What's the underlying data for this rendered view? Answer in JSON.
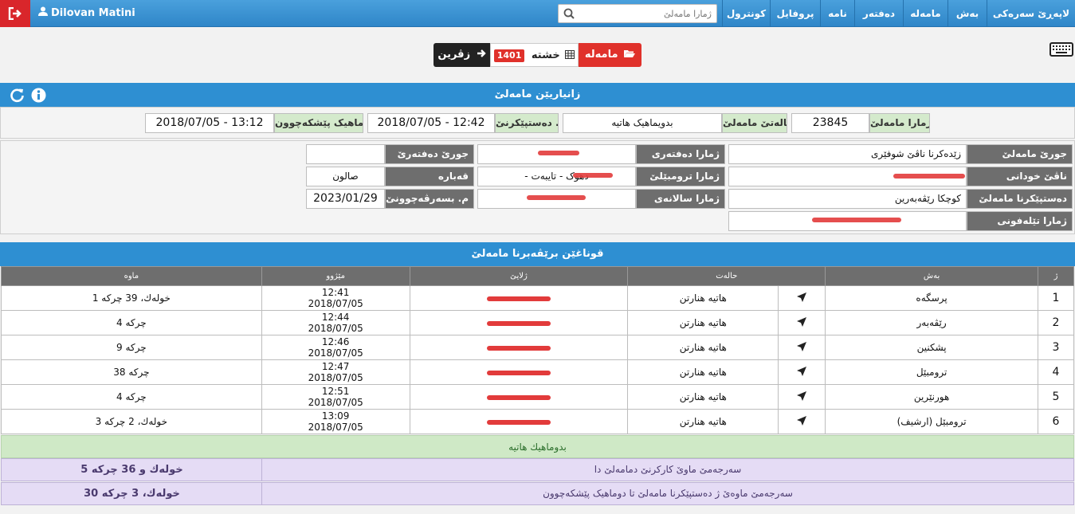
{
  "nav": {
    "user": "Dilovan Matini",
    "search_placeholder": "ژمارا مامەلێ",
    "items": [
      {
        "label": "لاپەڕێ سەرەکی"
      },
      {
        "label": "بەش"
      },
      {
        "label": "مامەلە"
      },
      {
        "label": "دەفتەر"
      },
      {
        "label": "نامە"
      },
      {
        "label": "پروفایل"
      },
      {
        "label": "کونترول"
      }
    ]
  },
  "buttons": {
    "case": "مامەلە",
    "steps": "خشتە",
    "steps_count": "1401",
    "back": "زڤرین"
  },
  "info_panel": {
    "title": "زانیاریێن مامەلێ",
    "case_number_label": "ژمارا مامەلێ",
    "case_number": "23845",
    "status_label": "حالەتێ مامەلێ",
    "status": "بدویماهیک هاتیە",
    "start_label": "م. دەستپێکرنێ",
    "start": "2018/07/05 - 12:42",
    "end_label": "دوماهیک پێشکەچوون",
    "end": "2018/07/05 - 13:12"
  },
  "details": {
    "col1": [
      {
        "label": "جورێ مامەلێ",
        "value": "زێدەکرنا ناڤێ شوفێری"
      },
      {
        "label": "ناڤێ خودانی",
        "value": ""
      },
      {
        "label": "دەستپێکرنا مامەلێ",
        "value": "کوچکا رێڤەبەرین"
      },
      {
        "label": "ژمارا تێلەفونی",
        "value": ""
      }
    ],
    "col2": [
      {
        "label": "ژمارا دەفتەری",
        "value": ""
      },
      {
        "label": "ژمارا ترومبێلێ",
        "value": "- دهوک - تایبەت"
      },
      {
        "label": "ژمارا سالانەی",
        "value": ""
      }
    ],
    "col3": [
      {
        "label": "جورێ دەفتەرێ",
        "value": ""
      },
      {
        "label": "قەبارە",
        "value": "صالون"
      },
      {
        "label": "م. بسەرڤەچوونێ",
        "value": "2023/01/29"
      }
    ]
  },
  "steps_panel": {
    "title": "قوناغێن برێڤەبرنا مامەلێ",
    "headers": {
      "no": "ژ",
      "dept": "بەش",
      "status": "حالەت",
      "user": "ژلایێ",
      "date": "مێژوو",
      "duration": "ماوە"
    },
    "rows": [
      {
        "no": "1",
        "dept": "پرسگەه",
        "status": "هاتیە هنارتن",
        "time": "12:41",
        "date": "2018/07/05",
        "duration": "1 خولەك، 39 چرکە"
      },
      {
        "no": "2",
        "dept": "رێڤەبەر",
        "status": "هاتیە هنارتن",
        "time": "12:44",
        "date": "2018/07/05",
        "duration": "4 چرکە"
      },
      {
        "no": "3",
        "dept": "پشکنین",
        "status": "هاتیە هنارتن",
        "time": "12:46",
        "date": "2018/07/05",
        "duration": "9 چرکە"
      },
      {
        "no": "4",
        "dept": "ترومبێل",
        "status": "هاتیە هنارتن",
        "time": "12:47",
        "date": "2018/07/05",
        "duration": "38 چرکە"
      },
      {
        "no": "5",
        "dept": "هورنێرین",
        "status": "هاتیە هنارتن",
        "time": "12:51",
        "date": "2018/07/05",
        "duration": "4 چرکە"
      },
      {
        "no": "6",
        "dept": "ترومبێل (ارشیف)",
        "status": "هاتیە هنارتن",
        "time": "13:09",
        "date": "2018/07/05",
        "duration": "3 خولەك، 2 چرکە"
      }
    ],
    "done_text": "بدوماهیك هاتیە",
    "summary": [
      {
        "label": "سەرجەمێ ماوێ کارکرنێ دمامەلێ دا",
        "value": "5 خولەك و 36 چرکە"
      },
      {
        "label": "سەرجەمێ ماوەێ ژ دەستپێکرنا مامەلێ تا دوماهیک پێشکەچوون",
        "value": "30 خولەك، 3 چرکە"
      }
    ]
  },
  "colors": {
    "navbar": "#2f86c8",
    "danger": "#e0312b",
    "header": "#2e8fd2",
    "label_green": "#d4eacc",
    "summary": "#e5dcf5"
  }
}
